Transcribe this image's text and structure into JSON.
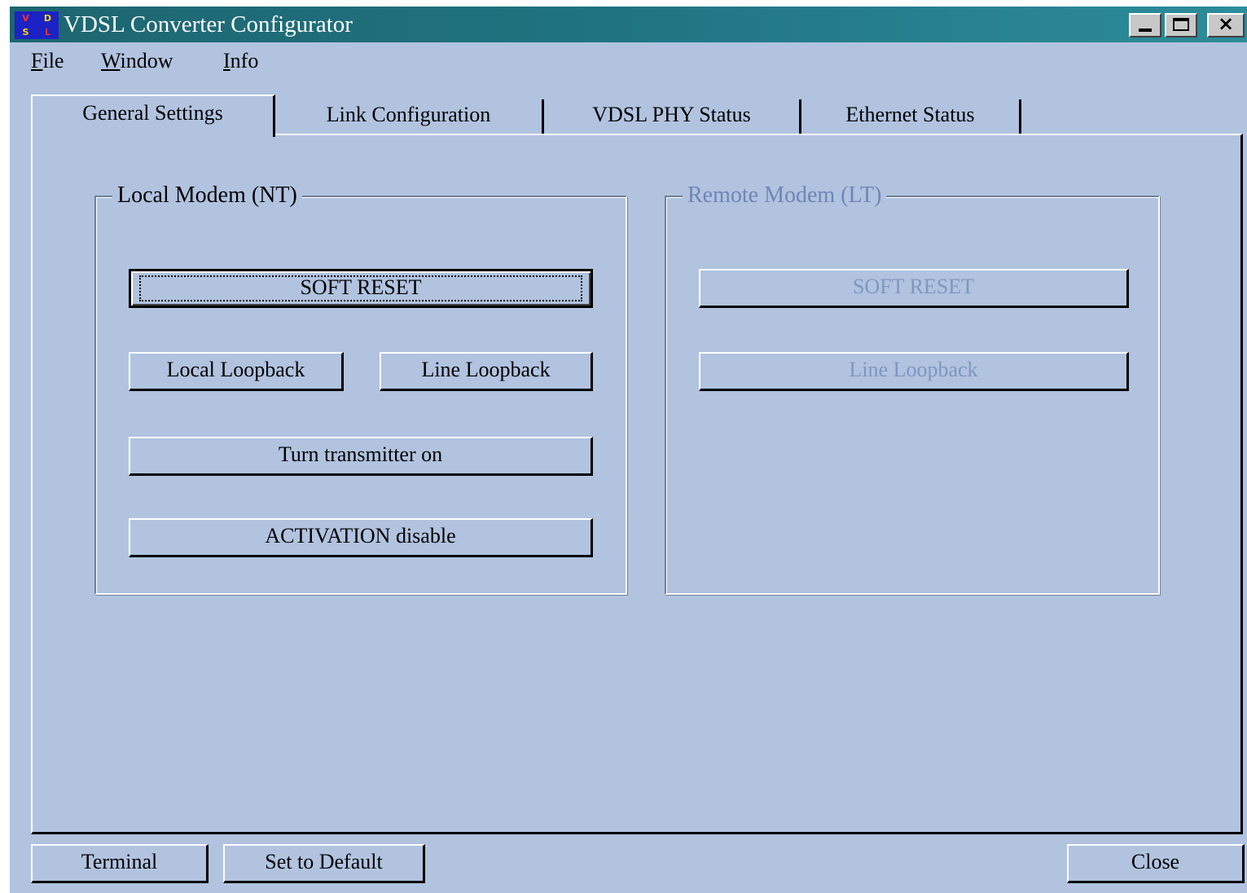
{
  "window": {
    "title": "VDSL Converter Configurator",
    "icon": {
      "name": "app-logo-icon",
      "glyphs": [
        "V",
        "D",
        "S",
        "L"
      ]
    },
    "controls": {
      "minimize": "minimize-icon",
      "maximize": "maximize-icon",
      "close": "×"
    }
  },
  "menu": {
    "items": [
      {
        "label": "File"
      },
      {
        "label": "Window"
      },
      {
        "label": "Info"
      }
    ]
  },
  "tabs": [
    {
      "label": "General Settings",
      "active": true
    },
    {
      "label": "Link Configuration",
      "active": false
    },
    {
      "label": "VDSL PHY Status",
      "active": false
    },
    {
      "label": "Ethernet Status",
      "active": false
    }
  ],
  "local_modem": {
    "title": "Local Modem (NT)",
    "soft_reset": "SOFT RESET",
    "local_loopback": "Local Loopback",
    "line_loopback": "Line Loopback",
    "transmitter": "Turn transmitter on",
    "activation": "ACTIVATION disable"
  },
  "remote_modem": {
    "title": "Remote Modem (LT)",
    "soft_reset": "SOFT RESET",
    "line_loopback": "Line Loopback",
    "enabled": false
  },
  "footer": {
    "terminal": "Terminal",
    "set_default": "Set to Default",
    "close": "Close"
  },
  "colors": {
    "background": "#b1c3df",
    "titlebar": "#1f7280",
    "disabled_text": "#7f96c2"
  }
}
